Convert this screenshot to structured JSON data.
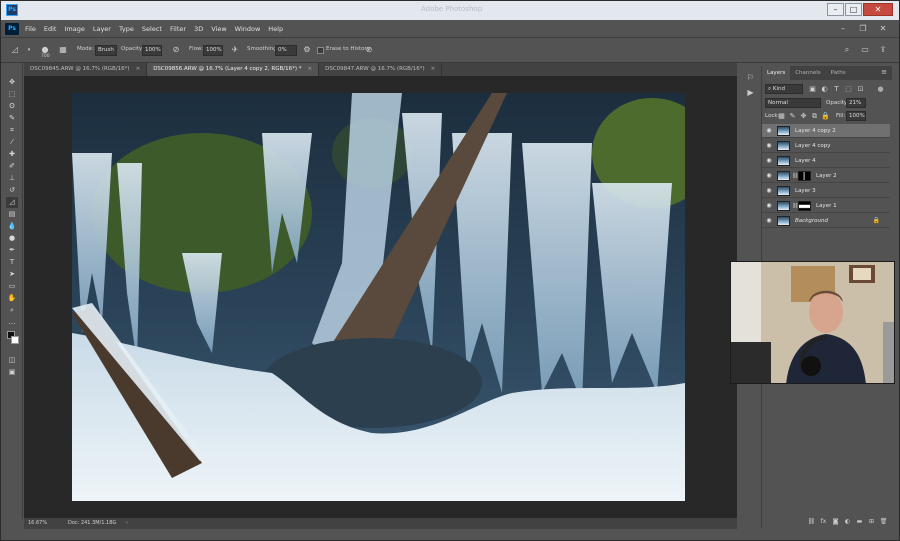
{
  "titlebar": {
    "title": "Adobe Photoshop",
    "logo": "Ps",
    "controls": [
      "minimize-icon",
      "maximize-icon",
      "close-icon"
    ]
  },
  "app": {
    "logo": "Ps"
  },
  "menu": [
    "File",
    "Edit",
    "Image",
    "Layer",
    "Type",
    "Select",
    "Filter",
    "3D",
    "View",
    "Window",
    "Help"
  ],
  "options": {
    "brush_size": "700",
    "mode_label": "Mode:",
    "mode_value": "Brush",
    "opacity_label": "Opacity:",
    "opacity_value": "100%",
    "flow_label": "Flow:",
    "flow_value": "100%",
    "smoothing_label": "Smoothing:",
    "smoothing_value": "0%",
    "erase_history_label": "Erase to History"
  },
  "tabs": [
    {
      "label": "DSC09845.ARW @ 16.7% (RGB/16*)",
      "active": false
    },
    {
      "label": "DSC09856.ARW @ 16.7% (Layer 4 copy 2, RGB/16*) *",
      "active": true
    },
    {
      "label": "DSC09847.ARW @ 16.7% (RGB/16*)",
      "active": false
    }
  ],
  "status": {
    "zoom": "16.67%",
    "doc": "Doc: 241.3M/1.18G"
  },
  "layers_panel": {
    "tabs": [
      "Layers",
      "Channels",
      "Paths"
    ],
    "filter_kind": "Kind",
    "blend_mode": "Normal",
    "opacity_label": "Opacity:",
    "opacity_value": "21%",
    "lock_label": "Lock:",
    "fill_label": "Fill:",
    "fill_value": "100%",
    "layers": [
      {
        "name": "Layer 4 copy 2",
        "selected": true,
        "mask": false
      },
      {
        "name": "Layer 4 copy",
        "selected": false,
        "mask": false
      },
      {
        "name": "Layer 4",
        "selected": false,
        "mask": false
      },
      {
        "name": "Layer 2",
        "selected": false,
        "mask": true
      },
      {
        "name": "Layer 3",
        "selected": false,
        "mask": false
      },
      {
        "name": "Layer 1",
        "selected": false,
        "mask": true
      },
      {
        "name": "Background",
        "selected": false,
        "mask": false,
        "italic": true,
        "locked": true
      }
    ]
  },
  "colors": {
    "accent": "#31a8ff",
    "panel_bg": "#535353",
    "canvas_bg": "#282828",
    "selected_layer": "#707070"
  }
}
